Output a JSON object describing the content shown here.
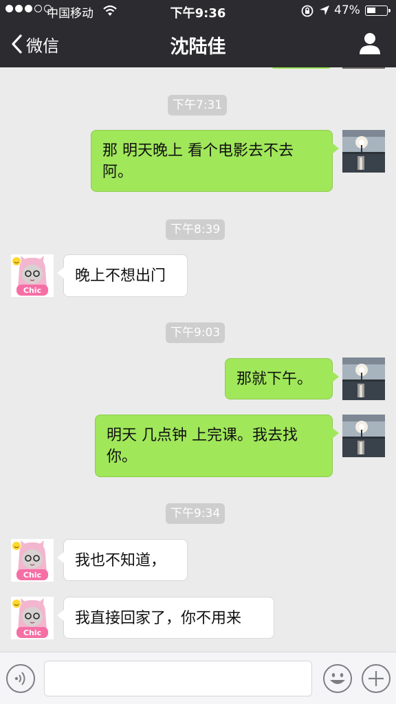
{
  "status_bar": {
    "carrier": "中国移动",
    "time": "下午9:36",
    "battery_percent_label": "47%",
    "battery_level": 0.47,
    "signal_bars_filled": 3,
    "signal_bars_total": 5
  },
  "nav": {
    "back_label": "微信",
    "title": "沈陆佳"
  },
  "colors": {
    "nav_background": "#2c2c30",
    "chat_background": "#ebebeb",
    "outgoing_bubble": "#a0e75a",
    "incoming_bubble": "#ffffff",
    "timestamp_pill": "#cecece"
  },
  "messages": [
    {
      "type": "time",
      "text": "下午7:31"
    },
    {
      "type": "outgoing",
      "text": "那 明天晚上  看个电影去不去阿。",
      "avatar": "sunset-river-avatar"
    },
    {
      "type": "time",
      "text": "下午8:39"
    },
    {
      "type": "incoming",
      "text": "晚上不想出门",
      "avatar": "cartoon-girl-avatar"
    },
    {
      "type": "time",
      "text": "下午9:03"
    },
    {
      "type": "outgoing",
      "text": "那就下午。",
      "avatar": "sunset-river-avatar"
    },
    {
      "type": "outgoing",
      "text": "明天 几点钟 上完课。我去找你。",
      "avatar": "sunset-river-avatar"
    },
    {
      "type": "time",
      "text": "下午9:34"
    },
    {
      "type": "incoming",
      "text": "我也不知道，",
      "avatar": "cartoon-girl-avatar"
    },
    {
      "type": "incoming",
      "text": "我直接回家了，你不用来",
      "avatar": "cartoon-girl-avatar"
    }
  ],
  "input_bar": {
    "placeholder": "",
    "voice_icon": "voice-icon",
    "emoji_icon": "emoji-icon",
    "more_icon": "plus-icon"
  }
}
